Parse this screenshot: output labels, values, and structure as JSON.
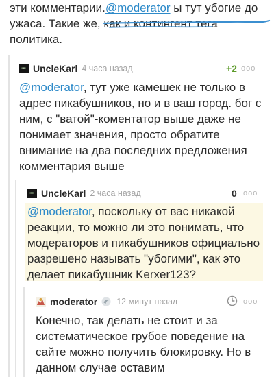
{
  "top": {
    "before": "эти комментарии.",
    "mention": "@moderator",
    "after": " ы тут убогие до ужаса. Такие же, как и контингент тега политика."
  },
  "comments": [
    {
      "author": "UncleKarl",
      "time": "4 часа назад",
      "rating": "+2",
      "menu": "ooo",
      "mention": "@moderator",
      "text": ",  тут уже камешек не только в адрес пикабушников, но и в ваш город. бог с ним, с \"ватой\"-коментатор выше даже не понимает значения, просто обратите внимание на два последних предложения комментария выше"
    },
    {
      "author": "UncleKarl",
      "time": "2 часа назад",
      "rating": "0",
      "menu": "ooo",
      "mention": "@moderator",
      "text": ", поскольку от вас никакой реакции, то можно ли это понимать, что модераторов и пикабушников официально разрешено называть \"убогими\", как это делает пикабушник Kerxer123?"
    },
    {
      "author": "moderator",
      "time": "12 минут назад",
      "menu": "ooo",
      "text": "Конечно, так делать не стоит и за систематическое грубое поведение на сайте можно получить блокировку. Но в данном случае оставим"
    }
  ],
  "colors": {
    "mention": "#2d8ac9",
    "rating_positive": "#5b9a28",
    "highlight": "#fcf8e3",
    "hand_stroke": "#3b8fd0"
  },
  "icons": {
    "menu": "more-dots-icon",
    "shield": "moderator-shield-icon",
    "clock": "clock-icon"
  }
}
